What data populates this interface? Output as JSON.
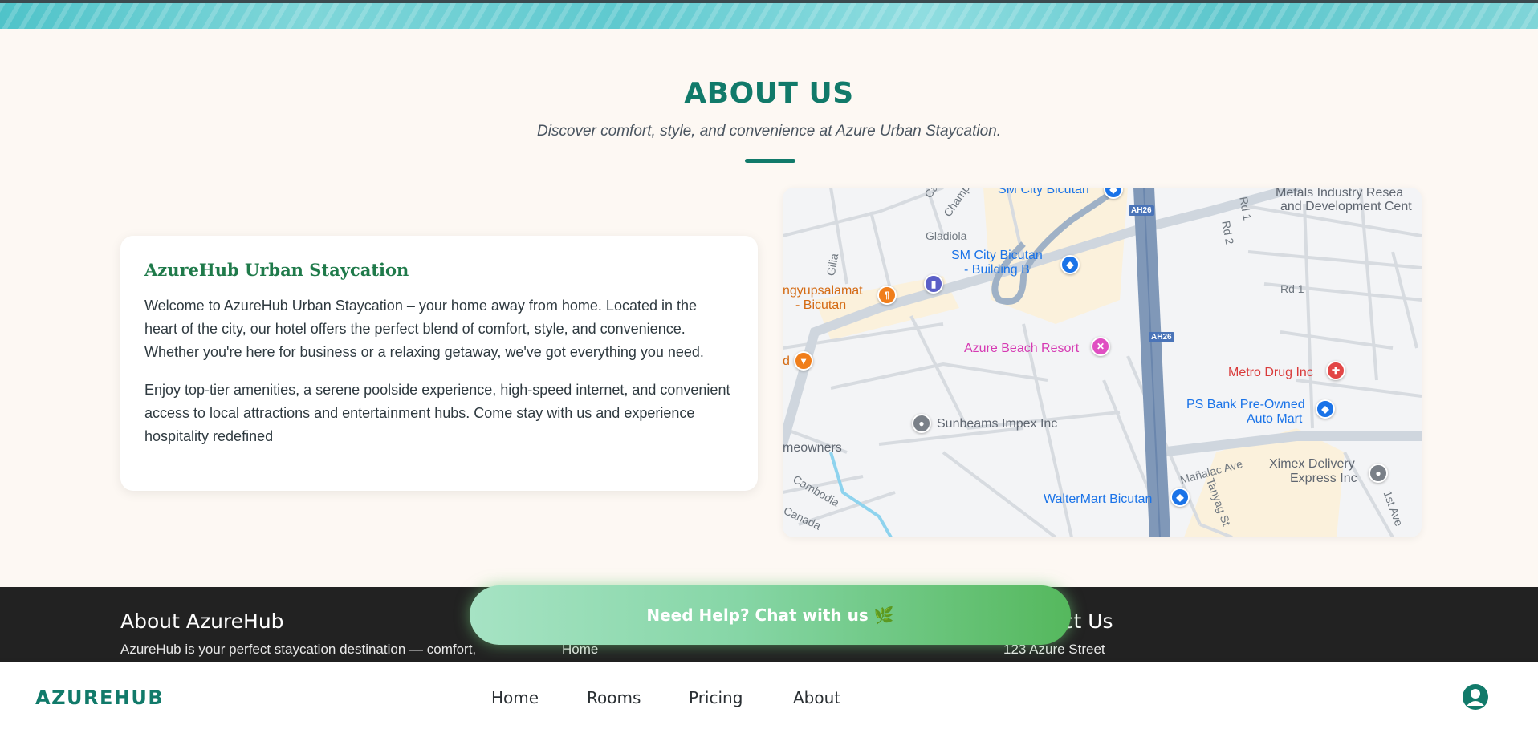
{
  "about": {
    "title": "ABOUT US",
    "subtitle": "Discover comfort, style, and convenience at Azure Urban Staycation.",
    "card": {
      "title": "AzureHub Urban Staycation",
      "paragraph1": "Welcome to AzureHub Urban Staycation – your home away from home. Located in the heart of the city, our hotel offers the perfect blend of comfort, style, and convenience. Whether you're here for business or a relaxing getaway, we've got everything you need.",
      "paragraph2": "Enjoy top-tier amenities, a serene poolside experience, high-speed internet, and convenient access to local attractions and entertainment hubs. Come stay with us and experience hospitality redefined"
    }
  },
  "map": {
    "places": {
      "sm_city": "SM City Bicutan",
      "sm_city_b": "SM City Bicutan",
      "sm_city_b2": "- Building B",
      "metals1": "Metals Industry Resea",
      "metals2": "and Development Cent",
      "mangyupsalamat1": "ngyupsalamat",
      "mangyupsalamat2": "- Bicutan",
      "azure_beach": "Azure Beach Resort",
      "metro_drug": "Metro Drug Inc",
      "ps_bank1": "PS Bank Pre-Owned",
      "ps_bank2": "Auto Mart",
      "sunbeams": "Sunbeams Impex Inc",
      "meowners": "meowners",
      "ximex1": "Ximex Delivery",
      "ximex2": "Express Inc",
      "waltermart": "WalterMart Bicutan",
      "d_label": "d"
    },
    "roads": {
      "gladiola": "Gladiola",
      "gilia": "Gilia",
      "champ": "Champ",
      "ca": "Ca",
      "rd1": "Rd 1",
      "rd1b": "Rd 1",
      "rd2": "Rd 2",
      "manalac": "Mañalac Ave",
      "tanyag": "Tanyag St",
      "first_ave": "1st Ave",
      "cambodia": "Cambodia",
      "canada": "Canada",
      "ah26a": "AH26",
      "ah26b": "AH26"
    }
  },
  "footer": {
    "about_title": "About AzureHub",
    "about_text": "AzureHub is your perfect staycation destination — comfort,",
    "links_first": "Home",
    "contact_title": "Contact Us",
    "contact_text": "123 Azure Street"
  },
  "chat": {
    "label": "Need Help? Chat with us 🌿"
  },
  "nav": {
    "brand": "AZUREHUB",
    "links": [
      "Home",
      "Rooms",
      "Pricing",
      "About"
    ],
    "user_icon": "user-circle-icon"
  },
  "colors": {
    "accent": "#117a6a",
    "card_title": "#1f7a4a",
    "footer_bg": "#222222",
    "chat_gradient_start": "#a6e3c4",
    "chat_gradient_end": "#55b85d"
  }
}
